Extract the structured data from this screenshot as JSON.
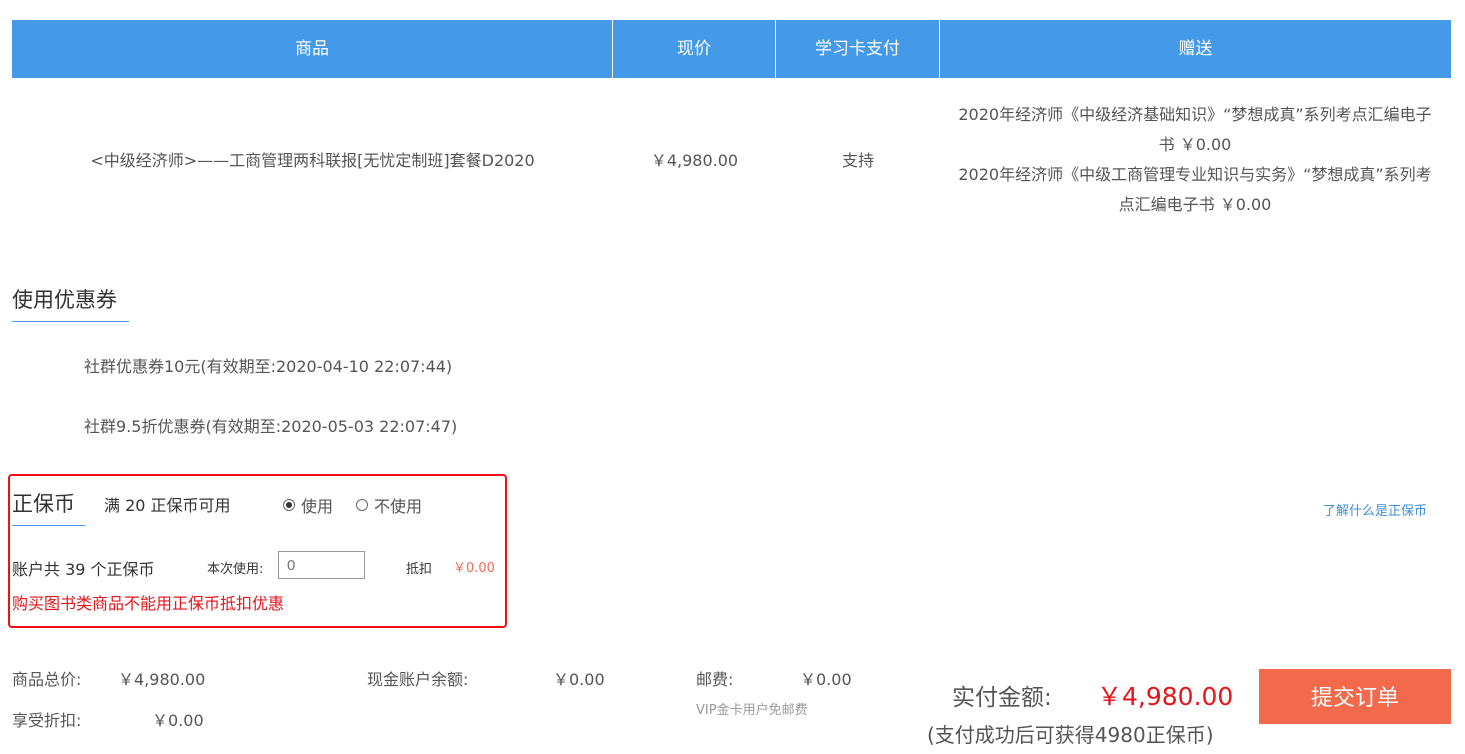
{
  "table": {
    "headers": [
      "商品",
      "现价",
      "学习卡支付",
      "赠送"
    ],
    "row": {
      "product": "<中级经济师>——工商管理两科联报[无忧定制班]套餐D2020",
      "price": "￥4,980.00",
      "card_pay": "支持",
      "gifts": [
        {
          "line1": "2020年经济师《中级经济基础知识》“梦想成真”系列考点汇编电子",
          "line2": "书 ￥0.00"
        },
        {
          "line1": "2020年经济师《中级工商管理专业知识与实务》“梦想成真”系列考",
          "line2": "点汇编电子书 ￥0.00"
        }
      ]
    }
  },
  "coupons": {
    "title": "使用优惠券",
    "items": [
      "社群优惠券10元(有效期至:2020-04-10 22:07:44)",
      "社群9.5折优惠券(有效期至:2020-05-03 22:07:47)"
    ]
  },
  "coins": {
    "title": "正保币",
    "rule": "满 20 正保币可用",
    "use_label": "使用",
    "no_use_label": "不使用",
    "learn_link": "了解什么是正保币",
    "account_text": "账户共 39 个正保币",
    "this_use_label": "本次使用:",
    "input_placeholder": "0",
    "deduct_label": "抵扣",
    "deduct_value": "￥0.00",
    "warning": "购买图书类商品不能用正保币抵扣优惠",
    "colors": {
      "warning": "#e4161b",
      "deduct": "#e86d5a",
      "link": "#3e8fd9",
      "box": "#f01010"
    }
  },
  "summary": {
    "total_label": "商品总价:",
    "total_value": "￥4,980.00",
    "discount_label": "享受折扣:",
    "discount_value": "￥0.00",
    "cash_label": "现金账户余额:",
    "cash_value": "￥0.00",
    "postage_label": "邮费:",
    "postage_value": "￥0.00",
    "vip_note": "VIP金卡用户免邮费",
    "pay_label": "实付金额:",
    "pay_value": "￥4,980.00",
    "earn_note": "(支付成功后可获得4980正保币)",
    "submit_label": "提交订单",
    "colors": {
      "pay_value": "#e4161b",
      "submit_bg": "#f26a4b"
    }
  }
}
